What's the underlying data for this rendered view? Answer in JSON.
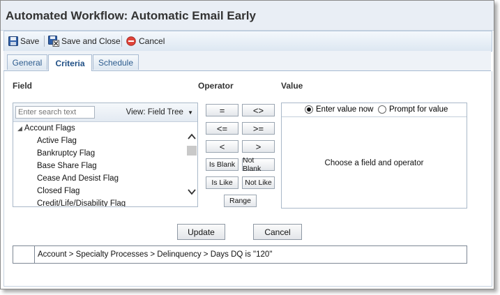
{
  "window": {
    "title": "Automated Workflow: Automatic Email Early"
  },
  "toolbar": {
    "save_label": "Save",
    "save_close_label": "Save and Close",
    "cancel_label": "Cancel"
  },
  "tabs": [
    {
      "label": "General",
      "active": false
    },
    {
      "label": "Criteria",
      "active": true
    },
    {
      "label": "Schedule",
      "active": false
    }
  ],
  "sections": {
    "field": "Field",
    "operator": "Operator",
    "value": "Value"
  },
  "field_panel": {
    "search_placeholder": "Enter search text",
    "view_label": "View: Field Tree",
    "tree": {
      "root": "Account Flags",
      "items": [
        "Active Flag",
        "Bankruptcy Flag",
        "Base Share Flag",
        "Cease And Desist Flag",
        "Closed Flag",
        "Credit/Life/Disability Flag"
      ]
    }
  },
  "operators": {
    "eq": "=",
    "neq": "<>",
    "lte": "<=",
    "gte": ">=",
    "lt": "<",
    "gt": ">",
    "is_blank": "Is Blank",
    "not_blank": "Not Blank",
    "is_like": "Is Like",
    "not_like": "Not Like",
    "range": "Range"
  },
  "value_panel": {
    "radio_enter": "Enter value now",
    "radio_prompt": "Prompt for value",
    "selected": "Enter value now",
    "message": "Choose a field and operator"
  },
  "actions": {
    "update": "Update",
    "cancel": "Cancel"
  },
  "criteria_result": "Account > Specialty Processes > Delinquency > Days DQ is \"120\"",
  "colors": {
    "tab_text": "#2d5c8e",
    "panel_border": "#a9b8c8",
    "header_bg": "#e9eef5"
  }
}
